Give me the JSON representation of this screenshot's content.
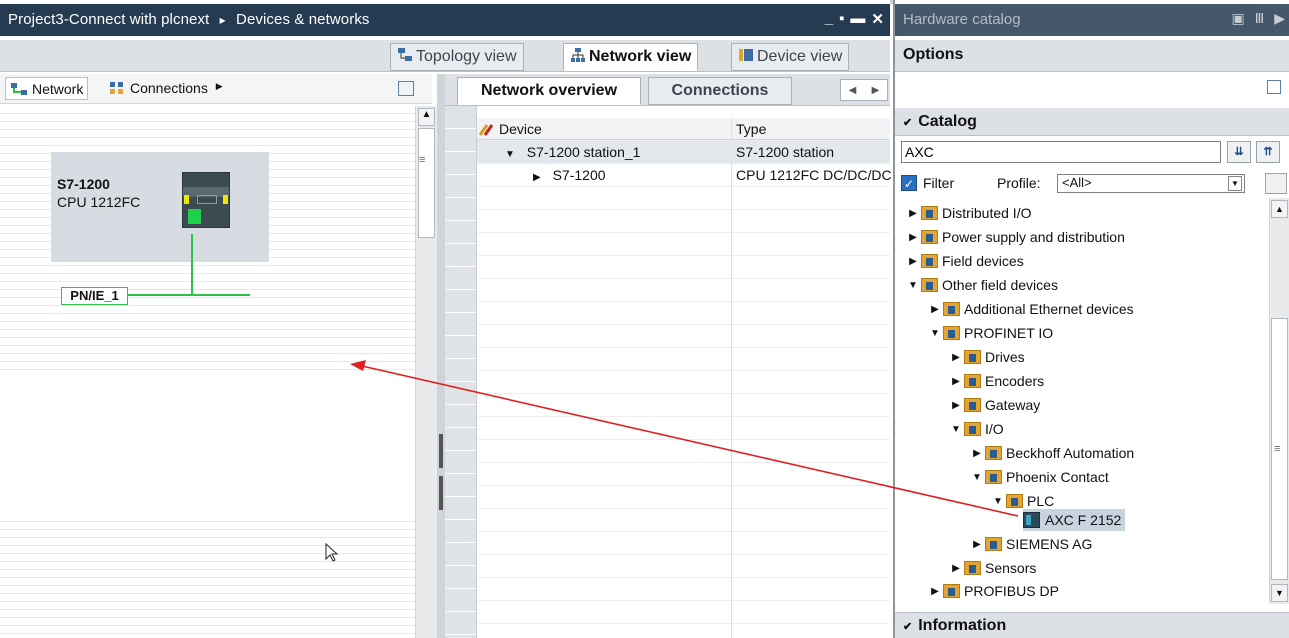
{
  "window": {
    "title": "Project3-Connect with plcnext",
    "breadcrumb_sep": "▸",
    "section": "Devices & networks",
    "controls": [
      "_",
      "▪",
      "▬",
      "✕"
    ]
  },
  "view_tabs": {
    "topology": "Topology view",
    "network": "Network view",
    "device": "Device view"
  },
  "editor_toolbar": {
    "network_label": "Network",
    "connections_label": "Connections"
  },
  "canvas": {
    "device_name": "S7-1200",
    "device_cpu": "CPU 1212FC",
    "subnet_label": "PN/IE_1"
  },
  "overview": {
    "tabs": [
      "Network overview",
      "Connections"
    ],
    "columns": [
      "Device",
      "Type"
    ],
    "rows": [
      {
        "device": "S7-1200 station_1",
        "type": "S7-1200 station",
        "toggle": "▼"
      },
      {
        "device": "S7-1200",
        "type": "CPU 1212FC DC/DC/DC",
        "toggle": "▶"
      }
    ]
  },
  "hardware_catalog": {
    "title": "Hardware catalog",
    "options_label": "Options",
    "catalog_label": "Catalog",
    "search_value": "AXC",
    "filter_label": "Filter",
    "profile_label": "Profile:",
    "profile_value": "<All>",
    "information_label": "Information",
    "tree": [
      {
        "label": "Distributed I/O",
        "toggle": "▶"
      },
      {
        "label": "Power supply and distribution",
        "toggle": "▶"
      },
      {
        "label": "Field devices",
        "toggle": "▶"
      },
      {
        "label": "Other field devices",
        "toggle": "▼"
      },
      {
        "label": "Additional Ethernet devices",
        "toggle": "▶"
      },
      {
        "label": "PROFINET IO",
        "toggle": "▼"
      },
      {
        "label": "Drives",
        "toggle": "▶"
      },
      {
        "label": "Encoders",
        "toggle": "▶"
      },
      {
        "label": "Gateway",
        "toggle": "▶"
      },
      {
        "label": "I/O",
        "toggle": "▼"
      },
      {
        "label": "Beckhoff Automation",
        "toggle": "▶"
      },
      {
        "label": "Phoenix Contact",
        "toggle": "▼"
      },
      {
        "label": "PLC",
        "toggle": "▼"
      },
      {
        "label": "AXC F 2152",
        "toggle": ""
      },
      {
        "label": "SIEMENS AG",
        "toggle": "▶"
      },
      {
        "label": "Sensors",
        "toggle": "▶"
      },
      {
        "label": "PROFIBUS DP",
        "toggle": "▶"
      }
    ]
  },
  "colors": {
    "titlebar": "#253b51",
    "subnet_green": "#2fc047",
    "drag_arrow": "#e02020",
    "selection": "#c7d3df"
  }
}
